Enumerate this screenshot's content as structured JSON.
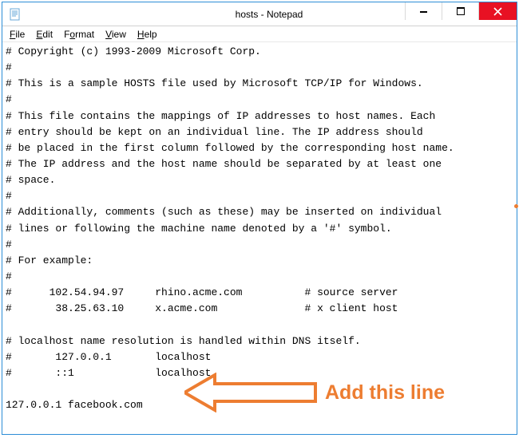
{
  "titlebar": {
    "title": "hosts - Notepad"
  },
  "menubar": {
    "file": "File",
    "edit": "Edit",
    "format": "Format",
    "view": "View",
    "help": "Help"
  },
  "editor": {
    "text": "# Copyright (c) 1993-2009 Microsoft Corp.\n#\n# This is a sample HOSTS file used by Microsoft TCP/IP for Windows.\n#\n# This file contains the mappings of IP addresses to host names. Each\n# entry should be kept on an individual line. The IP address should\n# be placed in the first column followed by the corresponding host name.\n# The IP address and the host name should be separated by at least one\n# space.\n#\n# Additionally, comments (such as these) may be inserted on individual\n# lines or following the machine name denoted by a '#' symbol.\n#\n# For example:\n#\n#      102.54.94.97     rhino.acme.com          # source server\n#       38.25.63.10     x.acme.com              # x client host\n\n# localhost name resolution is handled within DNS itself.\n#       127.0.0.1       localhost\n#       ::1             localhost\n\n127.0.0.1 facebook.com"
  },
  "annotation": {
    "label": "Add this line"
  }
}
